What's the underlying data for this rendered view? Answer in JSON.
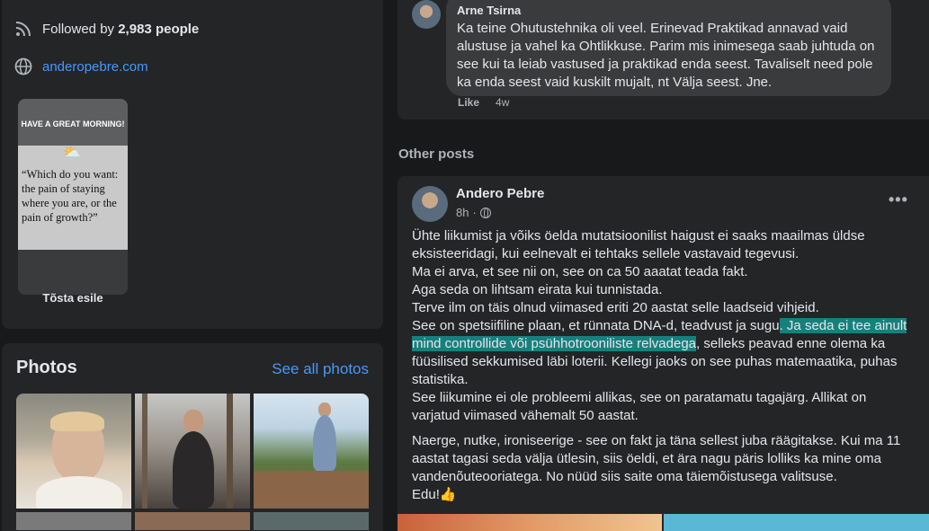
{
  "intro": {
    "followed_prefix": "Followed by",
    "followed_count": "2,983",
    "followed_suffix": "people",
    "website": "anderopebre.com"
  },
  "story": {
    "header": "HAVE A GREAT MORNING!",
    "quote": "“Which do you want: the pain of staying where you are, or the pain of growth?”",
    "button_label": "Tõsta esile"
  },
  "photos": {
    "title": "Photos",
    "see_all": "See all photos"
  },
  "comment": {
    "author": "Arne Tsirna",
    "text": "Ka teine Ohutustehnika oli veel. Erinevad Praktikad annavad vaid alustuse ja vahel ka Ohtlikkuse. Parim mis inimesega saab juhtuda on see kui ta leiab vastused ja praktikad enda seest. Tavaliselt need pole ka enda seest vaid kuskilt mujalt, nt Välja seest. Jne.",
    "like_label": "Like",
    "time": "4w"
  },
  "other_posts": {
    "title": "Other posts"
  },
  "post": {
    "author": "Andero Pebre",
    "time": "8h",
    "more_label": "•••",
    "lines": [
      "Ühte liikumist ja võiks öelda mutatsioonilist haigust ei saaks maailmas üldse eksisteeridagi, kui eelnevalt ei tehtaks sellele vastavaid tegevusi.",
      "Ma ei arva, et see nii on, see on ca 50 aaatat teada fakt.",
      "Aga seda on lihtsam eirata kui tunnistada.",
      "Terve ilm on täis olnud viimased eriti 20 aastat selle laadseid vihjeid."
    ],
    "line5_before": "See on spetsiifiline plaan, et rünnata DNA-d, teadvust ja sugu",
    "line5_highlight": ". Ja seda ei tee ainult mind controllide või psühhotrooniliste relvadega",
    "line5_after": ", selleks peavad enne olema ka füüsilised sekkumised läbi loterii. Kellegi jaoks on see puhas matemaatika, puhas statistika.",
    "line6": "See liikumine ei ole probleemi allikas, see on paratamatu tagajärg. Allikat on varjatud viimased vähemalt 50 aastat.",
    "para2": "Naerge, nutke, ironiseerige - see on fakt ja täna sellest juba räägitakse. Kui ma 11 aastat tagasi seda välja ütlesin, siis öeldi, et ära nagu päris lolliks ka mine oma vandenõuteooriatega. No nüüd siis saite oma täiemõistusega valitsuse.",
    "para2_end": "Edu!👍"
  },
  "icons": {
    "followers": "rss-icon",
    "website": "globe-icon",
    "privacy": "globe-icon",
    "more": "more-horizontal-icon"
  }
}
